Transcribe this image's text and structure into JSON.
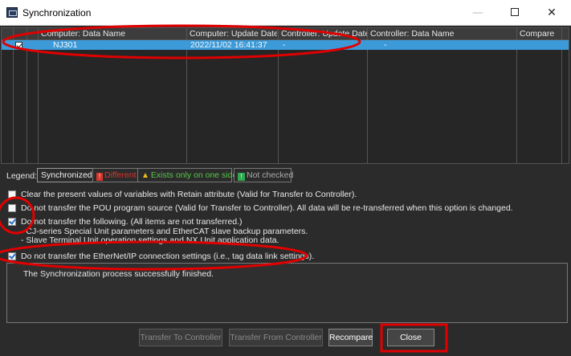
{
  "window": {
    "title": "Synchronization",
    "minimize": "—",
    "close": "✕"
  },
  "grid": {
    "columns": [
      "Computer: Data Name",
      "Computer: Update Date",
      "Controller: Update Date",
      "Controller: Data Name",
      "Compare"
    ],
    "rows": [
      {
        "checked": true,
        "computer_data_name": "NJ301",
        "computer_update_date": "2022/11/02 16:41:37",
        "controller_update_date": "-",
        "controller_data_name": "-",
        "compare": ""
      }
    ]
  },
  "legend": {
    "label": "Legend:",
    "synchronized": "Synchronized",
    "different": "Different",
    "one_side": "Exists only on one side",
    "not_checked": "Not checked"
  },
  "options": [
    {
      "checked": false,
      "text": "Clear the present values of variables with Retain attribute (Valid for Transfer to Controller)."
    },
    {
      "checked": false,
      "text": "Do not transfer the POU program source (Valid for Transfer to Controller). All data will be re-transferred when this option is changed."
    },
    {
      "checked": true,
      "text": "Do not transfer the following. (All items are not transferred.)",
      "sub": [
        "- CJ-series Special Unit parameters and EtherCAT slave backup parameters.",
        "- Slave Terminal Unit operation settings and NX Unit application data."
      ]
    },
    {
      "checked": true,
      "text": "Do not transfer the EtherNet/IP connection settings (i.e., tag data link settings)."
    }
  ],
  "message": "The Synchronization process successfully finished.",
  "buttons": {
    "transfer_to": "Transfer To Controller",
    "transfer_from": "Transfer From Controller",
    "recompare": "Recompare",
    "close": "Close"
  },
  "colors": {
    "annotation": "#e00000",
    "selected_row": "#3d9ad8",
    "dialog_bg": "#2b2b2b"
  }
}
